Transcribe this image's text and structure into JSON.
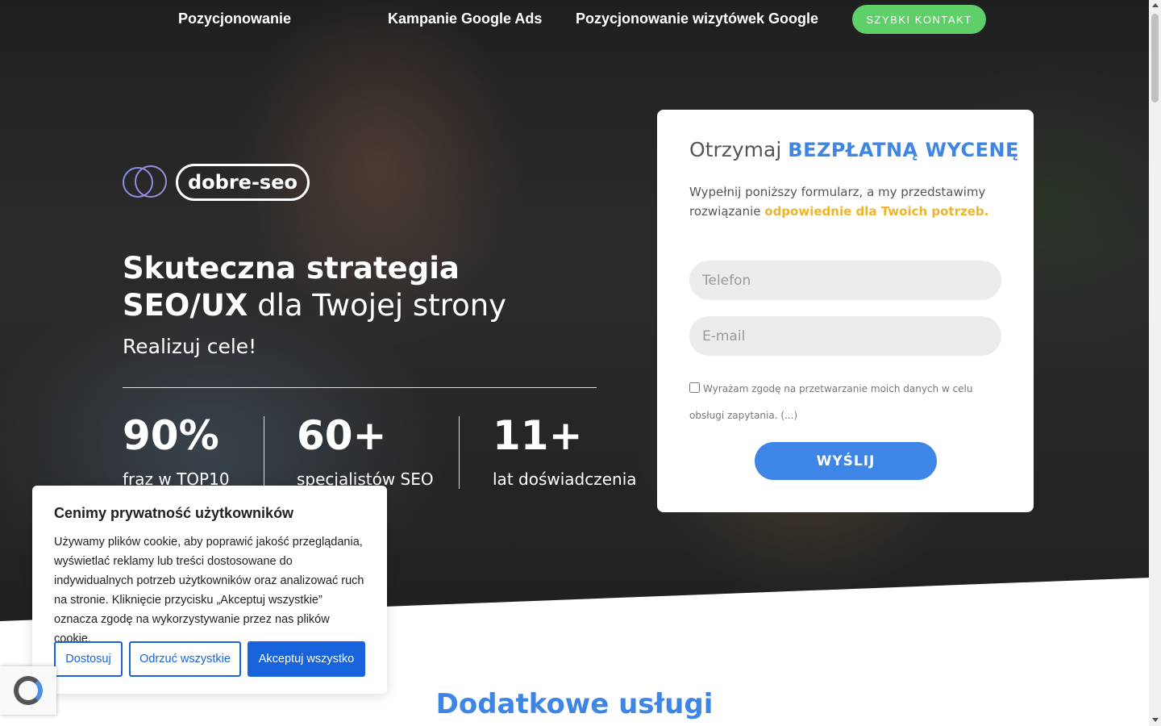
{
  "nav": {
    "items": [
      "Pozycjonowanie",
      "Kampanie Google Ads",
      "Pozycjonowanie wizytówek Google"
    ],
    "cta": "SZYBKI KONTAKT"
  },
  "logo": {
    "text": "dobre-seo"
  },
  "hero": {
    "title_line1": "Skuteczna strategia",
    "title_bold": "SEO/UX",
    "title_rest": " dla Twojej strony",
    "subtitle": "Realizuj cele!",
    "stats": [
      {
        "value": "90%",
        "label": "fraz w TOP10"
      },
      {
        "value": "60+",
        "label": "specjalistów SEO"
      },
      {
        "value": "11+",
        "label": "lat doświadczenia"
      }
    ]
  },
  "form": {
    "title_light": "Otrzymaj",
    "title_bold": "BEZPŁATNĄ WYCENĘ",
    "desc": "Wypełnij poniższy formularz, a my przedstawimy rozwiązanie ",
    "desc_highlight": "odpowiednie dla Twoich potrzeb.",
    "phone_placeholder": "Telefon",
    "email_placeholder": "E-mail",
    "consent": "Wyrażam zgodę na przetwarzanie moich danych w celu obsługi zapytania. (...)",
    "submit": "WYŚLIJ"
  },
  "section": {
    "title": "Dodatkowe usługi"
  },
  "cookie": {
    "title": "Cenimy prywatność użytkowników",
    "text": "Używamy plików cookie, aby poprawić jakość przeglądania, wyświetlać reklamy lub treści dostosowane do indywidualnych potrzeb użytkowników oraz analizować ruch na stronie. Kliknięcie przycisku „Akceptuj wszystkie” oznacza zgodę na wykorzystywanie przez nas plików cookie.",
    "btn_customize": "Dostosuj",
    "btn_reject": "Odrzuć wszystkie",
    "btn_accept": "Akceptuj wszystko"
  },
  "colors": {
    "accent": "#3d86e6",
    "cta_green": "#5fcf6a",
    "highlight": "#f0b428",
    "cookie_blue": "#1863dc"
  }
}
